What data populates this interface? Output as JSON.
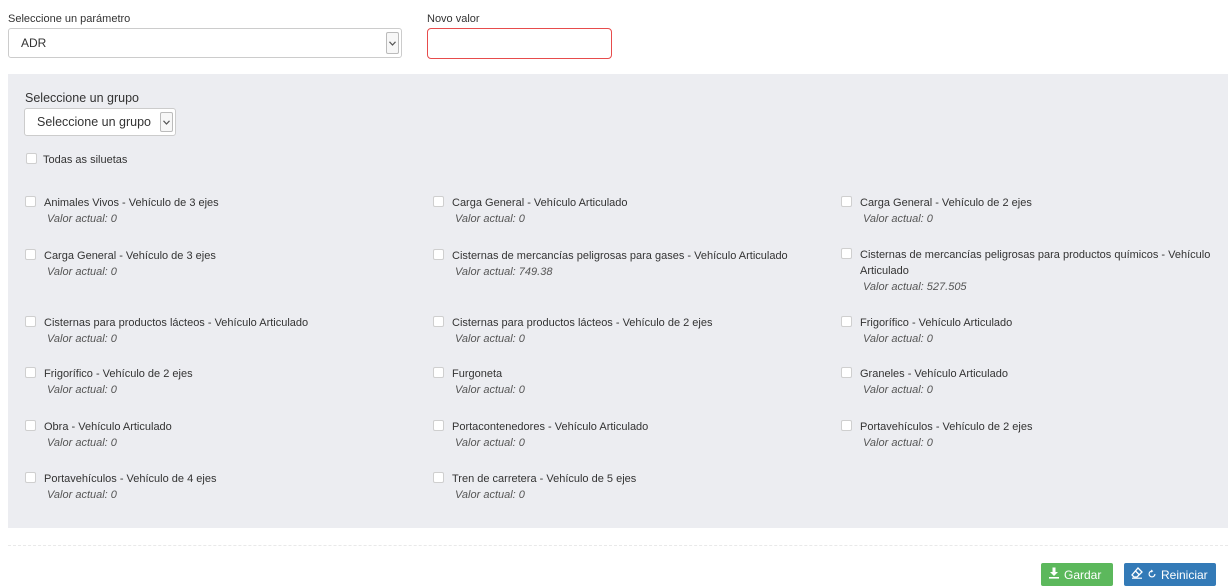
{
  "form": {
    "param_label": "Seleccione un parámetro",
    "param_value": "ADR",
    "new_value_label": "Novo valor",
    "new_value": ""
  },
  "group": {
    "label": "Seleccione un grupo",
    "select_value": "Seleccione un grupo",
    "all_label": "Todas as siluetas"
  },
  "items": [
    {
      "name": "Animales Vivos - Vehículo de 3 ejes",
      "current": "Valor actual: 0"
    },
    {
      "name": "Carga General - Vehículo Articulado",
      "current": "Valor actual: 0"
    },
    {
      "name": "Carga General - Vehículo de 2 ejes",
      "current": "Valor actual: 0"
    },
    {
      "name": "Carga General - Vehículo de 3 ejes",
      "current": "Valor actual: 0"
    },
    {
      "name": "Cisternas de mercancías peligrosas para gases - Vehículo Articulado",
      "current": "Valor actual: 749.38"
    },
    {
      "name": "Cisternas de mercancías peligrosas para productos químicos - Vehículo Articulado",
      "current": "Valor actual: 527.505"
    },
    {
      "name": "Cisternas para productos lácteos - Vehículo Articulado",
      "current": "Valor actual: 0"
    },
    {
      "name": "Cisternas para productos lácteos - Vehículo de 2 ejes",
      "current": "Valor actual: 0"
    },
    {
      "name": "Frigorífico - Vehículo Articulado",
      "current": "Valor actual: 0"
    },
    {
      "name": "Frigorífico - Vehículo de 2 ejes",
      "current": "Valor actual: 0"
    },
    {
      "name": "Furgoneta",
      "current": "Valor actual: 0"
    },
    {
      "name": "Graneles - Vehículo Articulado",
      "current": "Valor actual: 0"
    },
    {
      "name": "Obra - Vehículo Articulado",
      "current": "Valor actual: 0"
    },
    {
      "name": "Portacontenedores - Vehículo Articulado",
      "current": "Valor actual: 0"
    },
    {
      "name": "Portavehículos - Vehículo de 2 ejes",
      "current": "Valor actual: 0"
    },
    {
      "name": "Portavehículos - Vehículo de 4 ejes",
      "current": "Valor actual: 0"
    },
    {
      "name": "Tren de carretera - Vehículo de 5 ejes",
      "current": "Valor actual: 0"
    }
  ],
  "actions": {
    "save_label": "Gardar",
    "reset_label": "Reiniciar"
  },
  "colors": {
    "save": "#5cb85c",
    "reset": "#337ab7",
    "invalid_border": "#e74c4c",
    "panel_bg": "#ecedf1"
  },
  "icons": {
    "select_arrow": "chevron-down-icon",
    "save": "download-icon",
    "reset": "eraser-icon"
  }
}
